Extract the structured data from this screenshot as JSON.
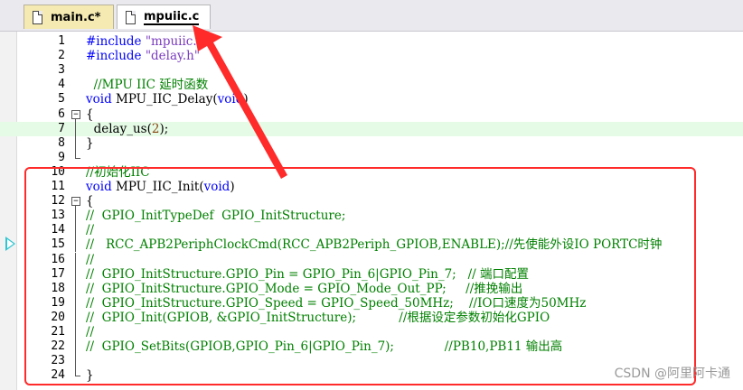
{
  "tabs": [
    {
      "label": "main.c*",
      "active": false
    },
    {
      "label": "mpuiic.c",
      "active": true
    }
  ],
  "lines": [
    {
      "n": "1",
      "fold": "none",
      "parts": [
        {
          "c": "pp",
          "t": "#include "
        },
        {
          "c": "str",
          "t": "\"mpuiic.h\""
        }
      ]
    },
    {
      "n": "2",
      "fold": "none",
      "parts": [
        {
          "c": "pp",
          "t": "#include "
        },
        {
          "c": "str",
          "t": "\"delay.h\""
        }
      ]
    },
    {
      "n": "3",
      "fold": "none",
      "parts": []
    },
    {
      "n": "4",
      "fold": "none",
      "parts": [
        {
          "c": "cm",
          "t": "  //MPU IIC 延时函数"
        }
      ]
    },
    {
      "n": "5",
      "fold": "none",
      "parts": [
        {
          "c": "kw",
          "t": "void"
        },
        {
          "c": "",
          "t": " MPU_IIC_Delay("
        },
        {
          "c": "kw",
          "t": "void"
        },
        {
          "c": "",
          "t": ")"
        }
      ]
    },
    {
      "n": "6",
      "fold": "open",
      "parts": [
        {
          "c": "",
          "t": "{"
        }
      ]
    },
    {
      "n": "7",
      "fold": "mid",
      "hl": true,
      "parts": [
        {
          "c": "",
          "t": "  delay_us("
        },
        {
          "c": "num",
          "t": "2"
        },
        {
          "c": "",
          "t": ");"
        }
      ]
    },
    {
      "n": "8",
      "fold": "mid",
      "parts": [
        {
          "c": "",
          "t": "}"
        }
      ]
    },
    {
      "n": "9",
      "fold": "end",
      "parts": []
    },
    {
      "n": "10",
      "fold": "none",
      "parts": [
        {
          "c": "cm",
          "t": "//初始化IIC"
        }
      ]
    },
    {
      "n": "11",
      "fold": "none",
      "parts": [
        {
          "c": "kw",
          "t": "void"
        },
        {
          "c": "",
          "t": " MPU_IIC_Init("
        },
        {
          "c": "kw",
          "t": "void"
        },
        {
          "c": "",
          "t": ")"
        }
      ]
    },
    {
      "n": "12",
      "fold": "open",
      "parts": [
        {
          "c": "",
          "t": "{"
        }
      ]
    },
    {
      "n": "13",
      "fold": "mid",
      "parts": [
        {
          "c": "cm",
          "t": "//  GPIO_InitTypeDef  GPIO_InitStructure;"
        }
      ]
    },
    {
      "n": "14",
      "fold": "mid",
      "parts": [
        {
          "c": "cm",
          "t": "//"
        }
      ]
    },
    {
      "n": "15",
      "fold": "mid",
      "parts": [
        {
          "c": "cm",
          "t": "//   RCC_APB2PeriphClockCmd(RCC_APB2Periph_GPIOB,ENABLE);//先使能外设IO PORTC时钟"
        }
      ]
    },
    {
      "n": "16",
      "fold": "mid",
      "parts": [
        {
          "c": "cm",
          "t": "//"
        }
      ]
    },
    {
      "n": "17",
      "fold": "mid",
      "parts": [
        {
          "c": "cm",
          "t": "//  GPIO_InitStructure.GPIO_Pin = GPIO_Pin_6|GPIO_Pin_7;   // 端口配置"
        }
      ]
    },
    {
      "n": "18",
      "fold": "mid",
      "parts": [
        {
          "c": "cm",
          "t": "//  GPIO_InitStructure.GPIO_Mode = GPIO_Mode_Out_PP;     //推挽输出"
        }
      ]
    },
    {
      "n": "19",
      "fold": "mid",
      "parts": [
        {
          "c": "cm",
          "t": "//  GPIO_InitStructure.GPIO_Speed = GPIO_Speed_50MHz;    //IO口速度为50MHz"
        }
      ]
    },
    {
      "n": "20",
      "fold": "mid",
      "parts": [
        {
          "c": "cm",
          "t": "//  GPIO_Init(GPIOB, &GPIO_InitStructure);           //根据设定参数初始化GPIO"
        }
      ]
    },
    {
      "n": "21",
      "fold": "mid",
      "parts": [
        {
          "c": "cm",
          "t": "//"
        }
      ]
    },
    {
      "n": "22",
      "fold": "mid",
      "parts": [
        {
          "c": "cm",
          "t": "//  GPIO_SetBits(GPIOB,GPIO_Pin_6|GPIO_Pin_7);             //PB10,PB11 输出高"
        }
      ]
    },
    {
      "n": "23",
      "fold": "mid",
      "parts": []
    },
    {
      "n": "24",
      "fold": "end",
      "parts": [
        {
          "c": "",
          "t": "}"
        }
      ]
    }
  ],
  "watermark": "CSDN @阿里阿卡通",
  "colors": {
    "keyword": "#0000ff",
    "comment": "#008000",
    "string": "#7a3bbf",
    "number": "#8b4513",
    "annotation": "#ff2a2a",
    "current_line_marker": "#2fc6d2"
  },
  "icons": {
    "tab_file": "file-icon",
    "current_line": "triangle-right-icon",
    "fold": "fold-box-icon"
  }
}
